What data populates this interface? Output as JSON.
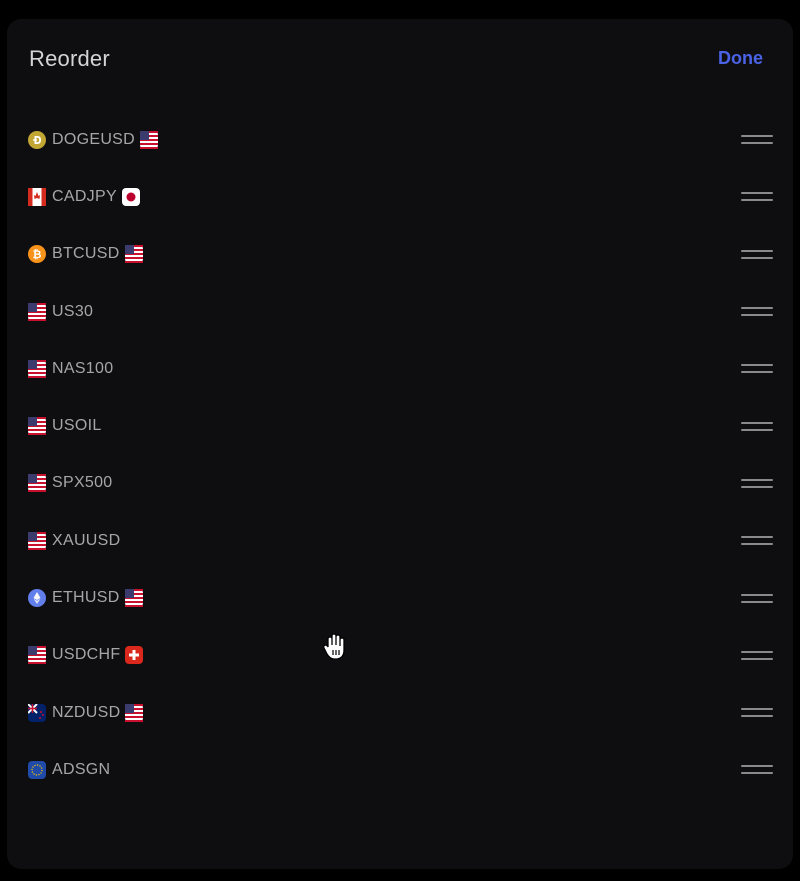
{
  "header": {
    "title": "Reorder",
    "done_label": "Done"
  },
  "colors": {
    "accent": "#4a63e6",
    "background": "#0e0e10",
    "text": "#a6a6aa"
  },
  "instruments": [
    {
      "symbol": "DOGEUSD",
      "base_icon": "doge-coin-icon",
      "quote_icon": "us-flag-icon"
    },
    {
      "symbol": "CADJPY",
      "base_icon": "canada-flag-icon",
      "quote_icon": "japan-flag-icon"
    },
    {
      "symbol": "BTCUSD",
      "base_icon": "bitcoin-icon",
      "quote_icon": "us-flag-icon"
    },
    {
      "symbol": "US30",
      "base_icon": "us-flag-icon",
      "quote_icon": null
    },
    {
      "symbol": "NAS100",
      "base_icon": "us-flag-icon",
      "quote_icon": null
    },
    {
      "symbol": "USOIL",
      "base_icon": "us-flag-icon",
      "quote_icon": null
    },
    {
      "symbol": "SPX500",
      "base_icon": "us-flag-icon",
      "quote_icon": null
    },
    {
      "symbol": "XAUUSD",
      "base_icon": "us-flag-icon",
      "quote_icon": null
    },
    {
      "symbol": "ETHUSD",
      "base_icon": "ethereum-icon",
      "quote_icon": "us-flag-icon"
    },
    {
      "symbol": "USDCHF",
      "base_icon": "us-flag-icon",
      "quote_icon": "swiss-flag-icon"
    },
    {
      "symbol": "NZDUSD",
      "base_icon": "new-zealand-flag-icon",
      "quote_icon": "us-flag-icon"
    },
    {
      "symbol": "ADSGN",
      "base_icon": "eu-flag-icon",
      "quote_icon": null
    }
  ]
}
